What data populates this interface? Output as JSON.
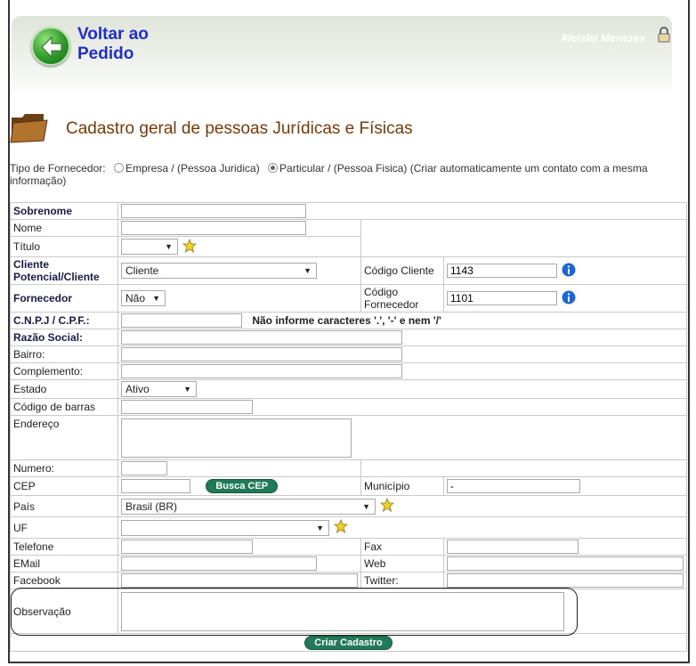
{
  "header": {
    "back_label": "Voltar ao Pedido",
    "user_name": "Alcislei Menezes"
  },
  "page": {
    "title": "Cadastro geral de pessoas Jurídicas e Físicas"
  },
  "supplier_type": {
    "label": "Tipo de Fornecedor:",
    "option_company": "Empresa / (Pessoa Juridica)",
    "option_individual": "Particular / (Pessoa Fisica) (Criar automaticamente um contato com a mesma informação)",
    "selected": "individual"
  },
  "form": {
    "sobrenome_label": "Sobrenome",
    "nome_label": "Nome",
    "titulo_label": "Título",
    "titulo_value": "",
    "cliente_label": "Cliente Potencial/Cliente",
    "cliente_value": "Cliente",
    "codigo_cliente_label": "Código Cliente",
    "codigo_cliente_value": "1143",
    "fornecedor_label": "Fornecedor",
    "fornecedor_value": "Não",
    "codigo_fornecedor_label": "Código Fornecedor",
    "codigo_fornecedor_value": "1101",
    "cnpj_label": "C.N.P.J / C.P.F.:",
    "cnpj_hint": "Não informe caracteres '.', '-' e nem '/'",
    "razao_label": "Razão Social:",
    "bairro_label": "Bairro:",
    "complemento_label": "Complemento:",
    "estado_label": "Estado",
    "estado_value": "Ativo",
    "codigo_barras_label": "Código de barras",
    "endereco_label": "Endereço",
    "numero_label": "Numero:",
    "cep_label": "CEP",
    "busca_cep_label": "Busca CEP",
    "municipio_label": "Município",
    "municipio_value": "-",
    "pais_label": "País",
    "pais_value": "Brasil (BR)",
    "uf_label": "UF",
    "uf_value": "",
    "telefone_label": "Telefone",
    "fax_label": "Fax",
    "email_label": "EMail",
    "web_label": "Web",
    "facebook_label": "Facebook",
    "twitter_label": "Twitter:",
    "observacao_label": "Observação",
    "submit_label": "Criar Cadastro"
  },
  "colors": {
    "title": "#7a3a06",
    "back_link": "#1f2fcf",
    "button": "#1f7a5a"
  }
}
